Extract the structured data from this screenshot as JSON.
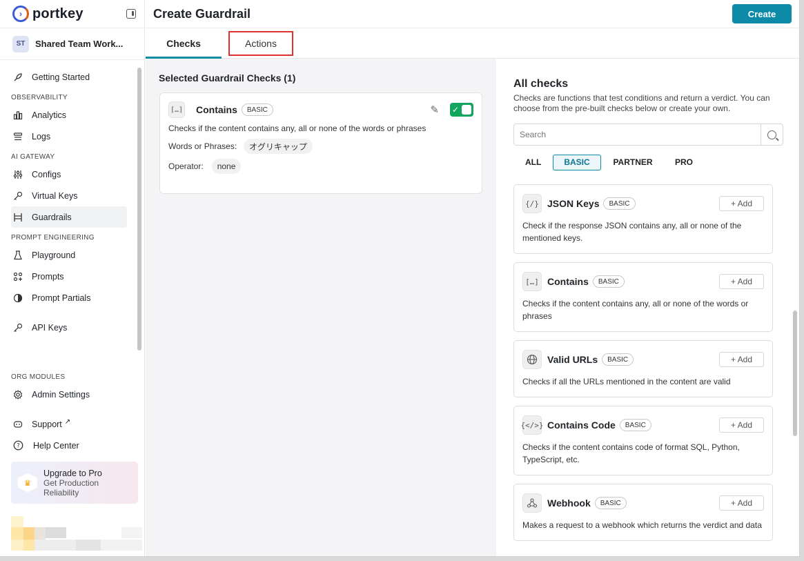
{
  "app": {
    "logo": "portkey"
  },
  "workspace": {
    "initials": "ST",
    "name": "Shared Team Work..."
  },
  "nav": {
    "getting_started": "Getting Started",
    "sections": [
      {
        "title": "OBSERVABILITY",
        "items": [
          {
            "label": "Analytics",
            "icon": "bar-chart-icon"
          },
          {
            "label": "Logs",
            "icon": "logs-icon"
          }
        ]
      },
      {
        "title": "AI GATEWAY",
        "items": [
          {
            "label": "Configs",
            "icon": "configs-icon"
          },
          {
            "label": "Virtual Keys",
            "icon": "key-icon"
          },
          {
            "label": "Guardrails",
            "icon": "guardrails-icon"
          }
        ]
      },
      {
        "title": "PROMPT ENGINEERING",
        "items": [
          {
            "label": "Playground",
            "icon": "flask-icon"
          },
          {
            "label": "Prompts",
            "icon": "prompts-icon"
          },
          {
            "label": "Prompt Partials",
            "icon": "partials-icon"
          }
        ]
      }
    ],
    "api_keys": "API Keys",
    "org_modules": "ORG MODULES",
    "admin_settings": "Admin Settings",
    "support": "Support",
    "help_center": "Help Center",
    "active_item": "Guardrails"
  },
  "upgrade": {
    "title": "Upgrade to Pro",
    "subtitle": "Get Production Reliability"
  },
  "header": {
    "title": "Create Guardrail",
    "create_label": "Create"
  },
  "tabs": {
    "checks": "Checks",
    "actions": "Actions"
  },
  "selected": {
    "title": "Selected Guardrail Checks (1)",
    "card": {
      "name": "Contains",
      "badge": "BASIC",
      "description": "Checks if the content contains any, all or none of the words or phrases",
      "words_label": "Words or Phrases:",
      "words_value": "オグリキャップ",
      "operator_label": "Operator:",
      "operator_value": "none",
      "enabled": true
    }
  },
  "all_checks": {
    "title": "All checks",
    "description": "Checks are functions that test conditions and return a verdict. You can choose from the pre-built checks below or create your own.",
    "search_placeholder": "Search",
    "filters": [
      "ALL",
      "BASIC",
      "PARTNER",
      "PRO"
    ],
    "active_filter": "BASIC",
    "add_label": "+ Add",
    "items": [
      {
        "name": "JSON Keys",
        "badge": "BASIC",
        "icon": "json-icon",
        "description": "Check if the response JSON contains any, all or none of the mentioned keys."
      },
      {
        "name": "Contains",
        "badge": "BASIC",
        "icon": "contains-icon",
        "description": "Checks if the content contains any, all or none of the words or phrases"
      },
      {
        "name": "Valid URLs",
        "badge": "BASIC",
        "icon": "globe-icon",
        "description": "Checks if all the URLs mentioned in the content are valid"
      },
      {
        "name": "Contains Code",
        "badge": "BASIC",
        "icon": "code-icon",
        "description": "Checks if the content contains code of format SQL, Python, TypeScript, etc."
      },
      {
        "name": "Webhook",
        "badge": "BASIC",
        "icon": "webhook-icon",
        "description": "Makes a request to a webhook which returns the verdict and data"
      }
    ]
  }
}
